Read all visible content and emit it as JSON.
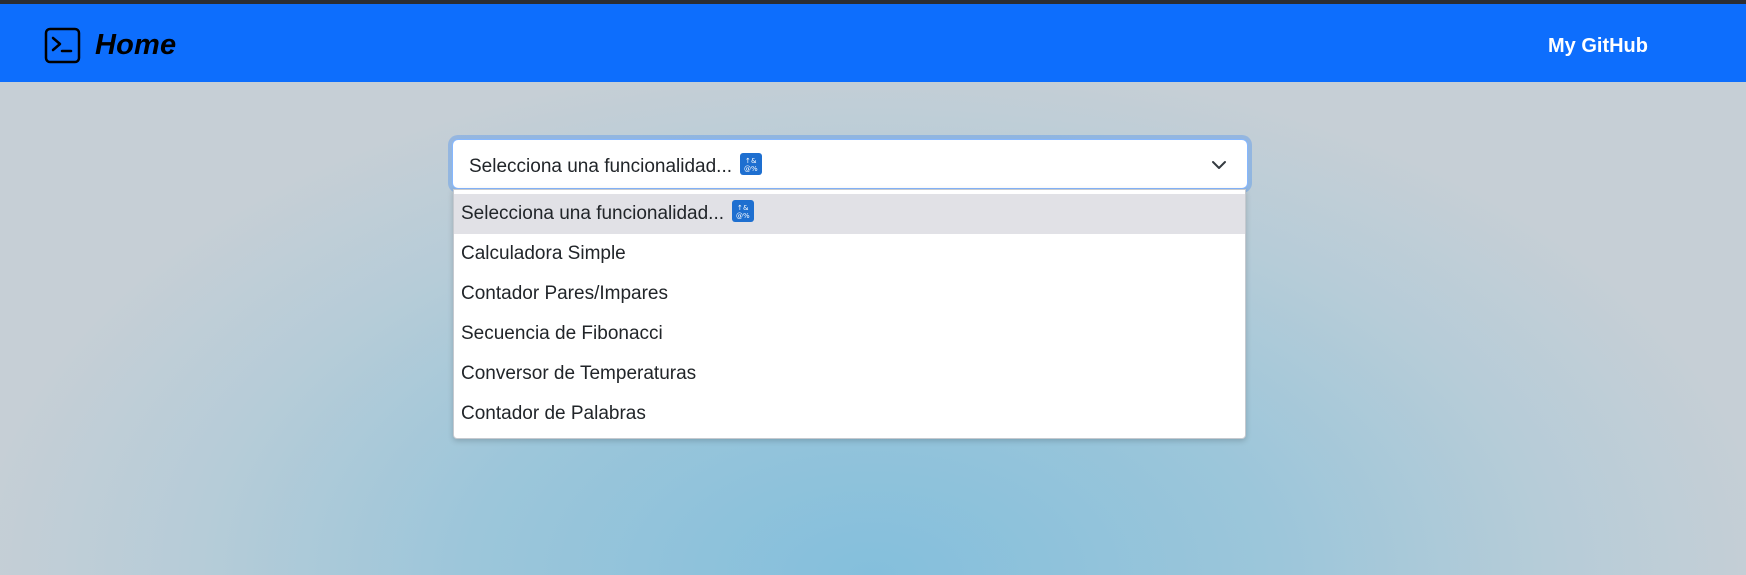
{
  "navbar": {
    "brand_label": "Home",
    "brand_icon": "terminal-icon",
    "github_link": "My GitHub",
    "background_color": "#0d6efd"
  },
  "select": {
    "current_value": "Selecciona una funcionalidad...",
    "value_emoji": "symbols-emoji-icon",
    "options": [
      {
        "label": "Selecciona una funcionalidad...",
        "selected": true
      },
      {
        "label": "Calculadora Simple",
        "selected": false
      },
      {
        "label": "Contador Pares/Impares",
        "selected": false
      },
      {
        "label": "Secuencia de Fibonacci",
        "selected": false
      },
      {
        "label": "Conversor de Temperaturas",
        "selected": false
      },
      {
        "label": "Contador de Palabras",
        "selected": false
      }
    ]
  }
}
